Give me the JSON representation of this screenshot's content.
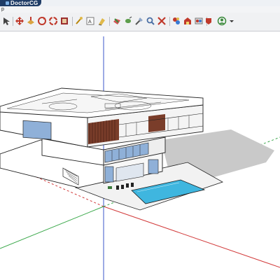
{
  "app": {
    "brand": "DoctorCG",
    "menu_fragment": "p"
  },
  "toolbar": {
    "buttons": [
      {
        "name": "select-icon"
      },
      {
        "name": "move-icon"
      },
      {
        "name": "push-pull-icon"
      },
      {
        "name": "rotate-icon"
      },
      {
        "name": "scale-icon"
      },
      {
        "name": "tape-measure-icon"
      },
      {
        "name": "text-icon"
      },
      {
        "name": "paint-bucket-icon"
      },
      {
        "name": "orbit-icon"
      },
      {
        "name": "pan-icon"
      },
      {
        "name": "zoom-icon"
      },
      {
        "name": "zoom-extents-icon"
      },
      {
        "name": "components-icon"
      },
      {
        "name": "materials-icon"
      },
      {
        "name": "styles-icon"
      },
      {
        "name": "warehouse-icon"
      },
      {
        "name": "extension-icon"
      },
      {
        "name": "user-account-icon"
      }
    ]
  },
  "colors": {
    "brand_bg": "#1f3c66",
    "axis_red": "#d23a3a",
    "axis_green": "#3aa84a",
    "axis_blue": "#3b55c8",
    "pool_water": "#3fb6df",
    "glass": "#8fb0d8",
    "shadow": "#c9c9c9",
    "wood_accent": "#7a3d2a"
  }
}
